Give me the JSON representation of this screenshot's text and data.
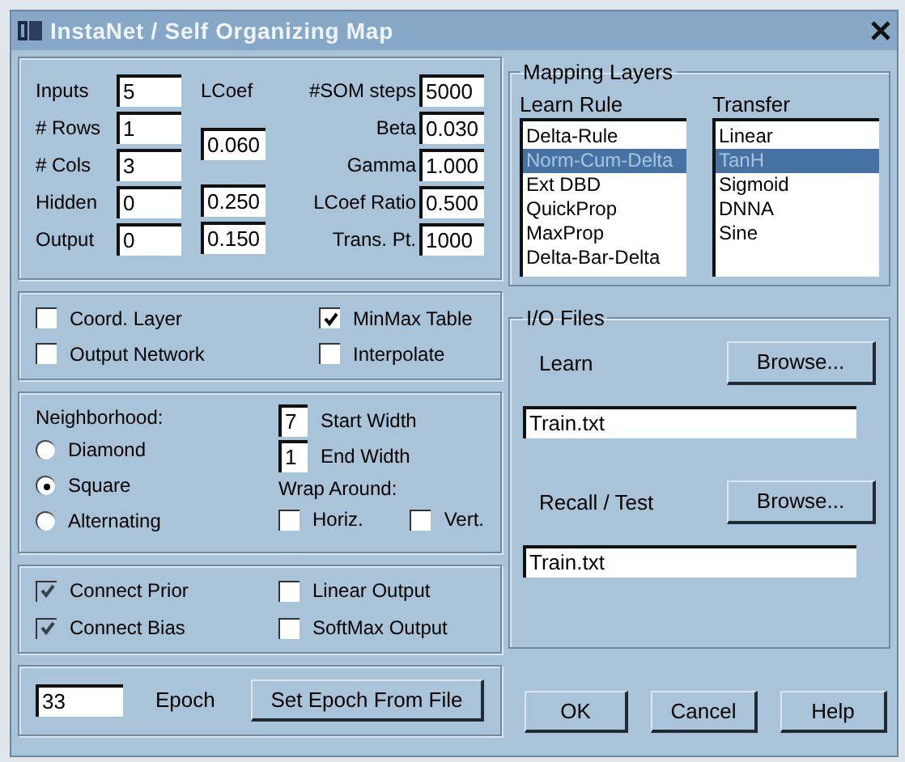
{
  "window": {
    "title": "InstaNet / Self Organizing Map"
  },
  "parameters": {
    "left": [
      {
        "label": "Inputs",
        "value": "5"
      },
      {
        "label": "# Rows",
        "value": "1"
      },
      {
        "label": "# Cols",
        "value": "3"
      },
      {
        "label": "Hidden",
        "value": "0"
      },
      {
        "label": "Output",
        "value": "0"
      }
    ],
    "lcoef": {
      "label": "LCoef",
      "values": [
        "0.060",
        "0.250",
        "0.150"
      ]
    },
    "right": [
      {
        "label": "#SOM steps",
        "value": "5000"
      },
      {
        "label": "Beta",
        "value": "0.030"
      },
      {
        "label": "Gamma",
        "value": "1.000"
      },
      {
        "label": "LCoef Ratio",
        "value": "0.500"
      },
      {
        "label": "Trans. Pt.",
        "value": "1000"
      }
    ]
  },
  "options": [
    {
      "label": "Coord. Layer",
      "checked": false
    },
    {
      "label": "MinMax Table",
      "checked": true
    },
    {
      "label": "Output Network",
      "checked": false
    },
    {
      "label": "Interpolate",
      "checked": false
    }
  ],
  "neighborhood": {
    "label": "Neighborhood:",
    "options": [
      {
        "label": "Diamond",
        "selected": false
      },
      {
        "label": "Square",
        "selected": true
      },
      {
        "label": "Alternating",
        "selected": false
      }
    ],
    "start_width": {
      "label": "Start Width",
      "value": "7"
    },
    "end_width": {
      "label": "End Width",
      "value": "1"
    },
    "wrap_around": {
      "label": "Wrap Around:",
      "options": [
        {
          "label": "Horiz.",
          "checked": false
        },
        {
          "label": "Vert.",
          "checked": false
        }
      ]
    }
  },
  "connections": [
    {
      "label": "Connect Prior",
      "checked": true,
      "disabled": true
    },
    {
      "label": "Linear Output",
      "checked": false,
      "disabled": false
    },
    {
      "label": "Connect Bias",
      "checked": true,
      "disabled": true
    },
    {
      "label": "SoftMax Output",
      "checked": false,
      "disabled": false
    }
  ],
  "epoch": {
    "value": "33",
    "label": "Epoch",
    "button": "Set Epoch From File"
  },
  "mapping_layers": {
    "title": "Mapping Layers",
    "learn_rule": {
      "label": "Learn Rule",
      "items": [
        {
          "label": "Delta-Rule",
          "selected": false
        },
        {
          "label": "Norm-Cum-Delta",
          "selected": true
        },
        {
          "label": "Ext DBD",
          "selected": false
        },
        {
          "label": "QuickProp",
          "selected": false
        },
        {
          "label": "MaxProp",
          "selected": false
        },
        {
          "label": "Delta-Bar-Delta",
          "selected": false
        }
      ]
    },
    "transfer": {
      "label": "Transfer",
      "items": [
        {
          "label": "Linear",
          "selected": false
        },
        {
          "label": "TanH",
          "selected": true
        },
        {
          "label": "Sigmoid",
          "selected": false
        },
        {
          "label": "DNNA",
          "selected": false
        },
        {
          "label": "Sine",
          "selected": false
        }
      ]
    }
  },
  "io_files": {
    "title": "I/O Files",
    "learn": {
      "label": "Learn",
      "button": "Browse...",
      "value": "Train.txt"
    },
    "recall": {
      "label": "Recall / Test",
      "button": "Browse...",
      "value": "Train.txt"
    }
  },
  "buttons": [
    "OK",
    "Cancel",
    "Help"
  ]
}
